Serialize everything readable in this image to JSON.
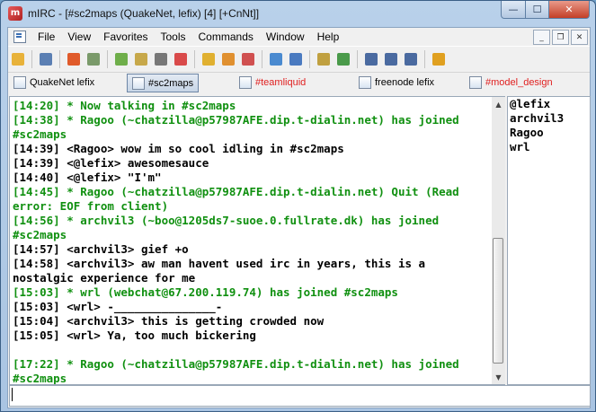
{
  "window": {
    "app_icon_text": "m",
    "title": "mIRC - [#sc2maps (QuakeNet, lefix) [4] [+CnNt]]",
    "min_glyph": "—",
    "max_glyph": "☐",
    "close_glyph": "✕"
  },
  "menubar": {
    "items": [
      {
        "label": "File"
      },
      {
        "label": "View"
      },
      {
        "label": "Favorites"
      },
      {
        "label": "Tools"
      },
      {
        "label": "Commands"
      },
      {
        "label": "Window"
      },
      {
        "label": "Help"
      }
    ],
    "mdi_min": "_",
    "mdi_restore": "❐",
    "mdi_close": "✕"
  },
  "toolbar": {
    "buttons": [
      {
        "icon": "connect-icon",
        "color": "#e8b23a"
      },
      {
        "icon": "disconnect-icon",
        "color": "#5b7fb3"
      },
      {
        "icon": "favorites-icon",
        "color": "#e05a2a"
      },
      {
        "icon": "options-icon",
        "color": "#7a9a6a"
      },
      {
        "icon": "channels-list-icon",
        "color": "#6fae4a"
      },
      {
        "icon": "address-book-icon",
        "color": "#c7a84a"
      },
      {
        "icon": "clock-icon",
        "color": "#777777"
      },
      {
        "icon": "colors-icon",
        "color": "#d94a4a"
      },
      {
        "icon": "notify-icon",
        "color": "#e0b030"
      },
      {
        "icon": "dcc-send-icon",
        "color": "#e09030"
      },
      {
        "icon": "dcc-chat-icon",
        "color": "#d05050"
      },
      {
        "icon": "sounds-icon",
        "color": "#4a8ad0"
      },
      {
        "icon": "scripts-icon",
        "color": "#4a7ac0"
      },
      {
        "icon": "logs-icon",
        "color": "#c0a040"
      },
      {
        "icon": "received-icon",
        "color": "#4a9a4a"
      },
      {
        "icon": "tile-horizontal-icon",
        "color": "#4a6aa0"
      },
      {
        "icon": "tile-vertical-icon",
        "color": "#4a6aa0"
      },
      {
        "icon": "cascade-icon",
        "color": "#4a6aa0"
      },
      {
        "icon": "about-icon",
        "color": "#e0a020"
      }
    ]
  },
  "switchbar": {
    "tabs": [
      {
        "label": "QuakeNet lefix",
        "active": false,
        "color": "#000000"
      },
      {
        "label": "#sc2maps",
        "active": true,
        "color": "#000000"
      },
      {
        "label": "#teamliquid",
        "active": false,
        "color": "#e02020"
      },
      {
        "label": "freenode lefix",
        "active": false,
        "color": "#000000"
      },
      {
        "label": "#model_design",
        "active": false,
        "color": "#e02020"
      }
    ]
  },
  "chat": {
    "lines": [
      {
        "kind": "join",
        "text": "[14:20] * Now talking in #sc2maps"
      },
      {
        "kind": "join",
        "text": "[14:38] * Ragoo (~chatzilla@p57987AFE.dip.t-dialin.net) has joined #sc2maps"
      },
      {
        "kind": "msg",
        "text": "[14:39] <Ragoo> wow im so cool idling in #sc2maps"
      },
      {
        "kind": "msg",
        "text": "[14:39] <@lefix> awesomesauce"
      },
      {
        "kind": "msg",
        "text": "[14:40] <@lefix> \"I'm\""
      },
      {
        "kind": "quit",
        "text": "[14:45] * Ragoo (~chatzilla@p57987AFE.dip.t-dialin.net) Quit (Read error: EOF from client)"
      },
      {
        "kind": "join",
        "text": "[14:56] * archvil3 (~boo@1205ds7-suoe.0.fullrate.dk) has joined #sc2maps"
      },
      {
        "kind": "msg",
        "text": "[14:57] <archvil3> gief +o"
      },
      {
        "kind": "msg",
        "text": "[14:58] <archvil3> aw man havent used irc in years, this is a nostalgic experience for me"
      },
      {
        "kind": "join",
        "text": "[15:03] * wrl (webchat@67.200.119.74) has joined #sc2maps"
      },
      {
        "kind": "msg",
        "text": "[15:03] <wrl> -_______________-"
      },
      {
        "kind": "msg",
        "text": "[15:04] <archvil3> this is getting crowded now"
      },
      {
        "kind": "msg",
        "text": "[15:05] <wrl> Ya, too much bickering"
      },
      {
        "kind": "gap",
        "text": ""
      },
      {
        "kind": "join",
        "text": "[17:22] * Ragoo (~chatzilla@p57987AFE.dip.t-dialin.net) has joined #sc2maps"
      }
    ]
  },
  "scrollbar": {
    "up": "▲",
    "down": "▼"
  },
  "nicklist": {
    "nicks": [
      "@lefix",
      "archvil3",
      "Ragoo",
      "wrl"
    ]
  },
  "editbox": {
    "value": ""
  }
}
